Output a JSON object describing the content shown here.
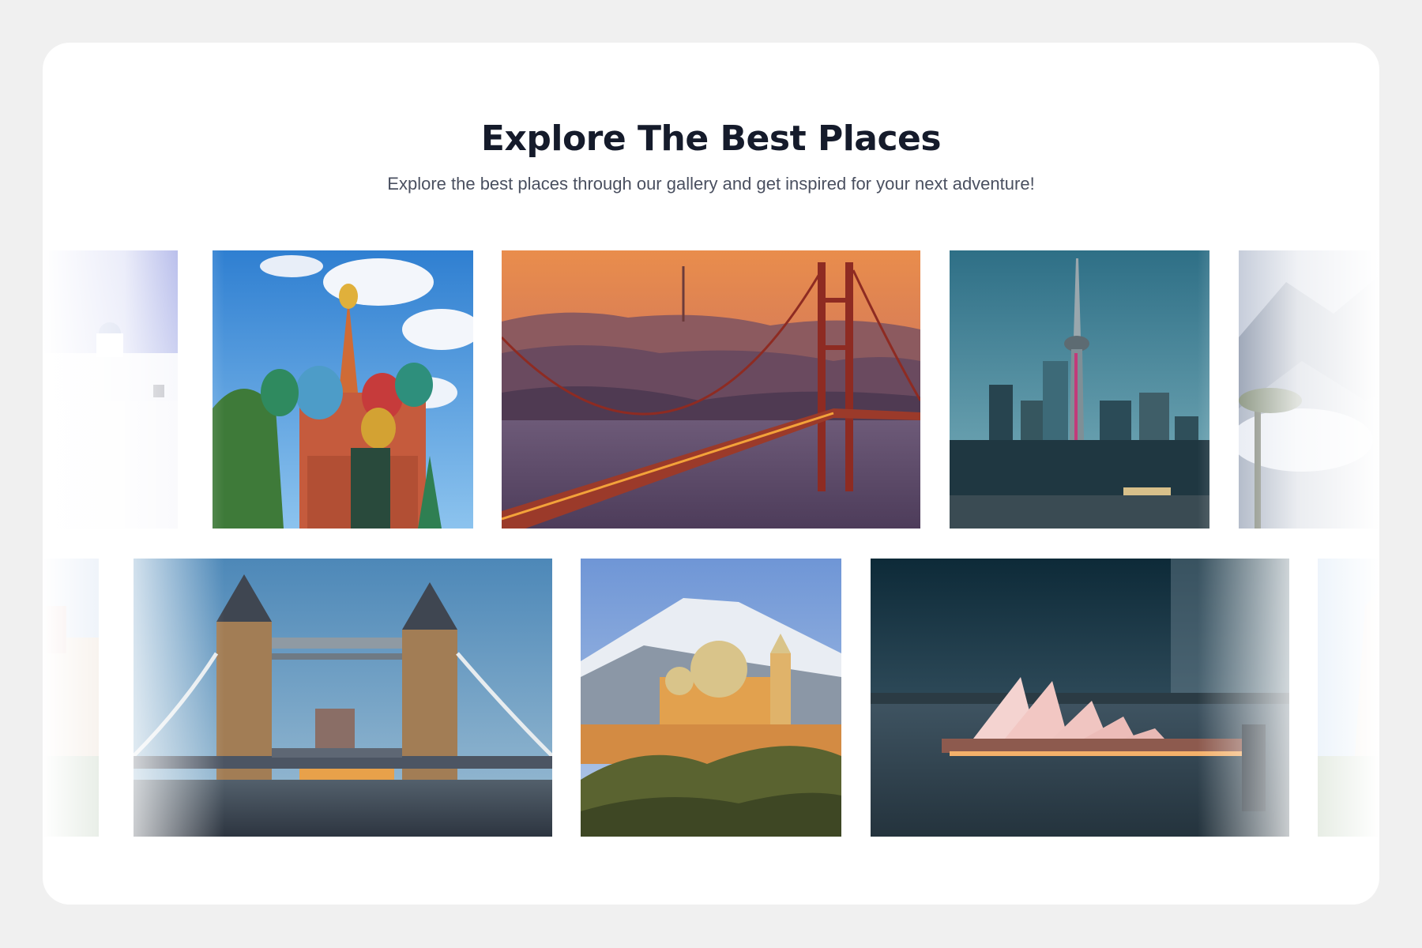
{
  "header": {
    "title": "Explore The Best Places",
    "subtitle": "Explore the best places through our gallery and get inspired for your next adventure!"
  },
  "gallery": {
    "row1": [
      {
        "name": "santorini-photo"
      },
      {
        "name": "saint-basils-cathedral-photo"
      },
      {
        "name": "golden-gate-bridge-photo"
      },
      {
        "name": "toronto-cn-tower-photo"
      },
      {
        "name": "misty-mountains-photo"
      }
    ],
    "row2": [
      {
        "name": "temple-photo"
      },
      {
        "name": "tower-bridge-photo"
      },
      {
        "name": "cholula-church-volcano-photo"
      },
      {
        "name": "sydney-opera-house-photo"
      },
      {
        "name": "gothic-tower-photo"
      }
    ]
  },
  "colors": {
    "background": "#f0f0f0",
    "card": "#ffffff",
    "title": "#151b2b",
    "subtitle": "#4a5060"
  }
}
